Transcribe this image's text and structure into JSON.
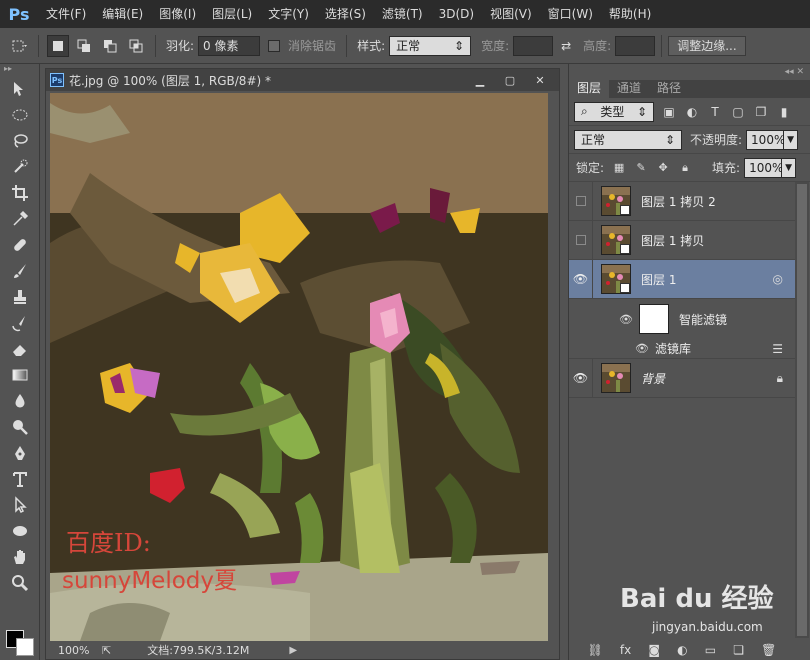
{
  "app": {
    "logo": "Ps"
  },
  "menu": [
    "文件(F)",
    "编辑(E)",
    "图像(I)",
    "图层(L)",
    "文字(Y)",
    "选择(S)",
    "滤镜(T)",
    "3D(D)",
    "视图(V)",
    "窗口(W)",
    "帮助(H)"
  ],
  "options": {
    "feather_label": "羽化:",
    "feather_value": "0 像素",
    "antialias_label": "消除锯齿",
    "style_label": "样式:",
    "style_value": "正常",
    "width_label": "宽度:",
    "height_label": "高度:",
    "refine_edge": "调整边缘..."
  },
  "document": {
    "title": "花.jpg @ 100% (图层 1, RGB/8#) *",
    "watermark_line1": "百度ID:",
    "watermark_line2": "sunnyMelody夏",
    "zoom": "100%",
    "doc_info": "文档:799.5K/3.12M"
  },
  "panel": {
    "tabs": [
      "图层",
      "通道",
      "路径"
    ],
    "filter_kind": "类型",
    "blend_mode": "正常",
    "opacity_label": "不透明度:",
    "opacity_value": "100%",
    "lock_label": "锁定:",
    "fill_label": "填充:",
    "fill_value": "100%"
  },
  "layers": [
    {
      "name": "图层 1 拷贝 2",
      "visible": false,
      "selected": false
    },
    {
      "name": "图层 1 拷贝",
      "visible": false,
      "selected": false
    },
    {
      "name": "图层 1",
      "visible": true,
      "selected": true
    },
    {
      "name": "背景",
      "visible": true,
      "selected": false
    }
  ],
  "smart_filters": {
    "label": "智能滤镜",
    "item": "滤镜库"
  },
  "watermark": {
    "brand": "Bai du 经验",
    "url": "jingyan.baidu.com"
  },
  "colors": {
    "accent": "#6b7fa0",
    "watermark_text": "#d6463a",
    "ps_blue": "#7fc2ff"
  }
}
